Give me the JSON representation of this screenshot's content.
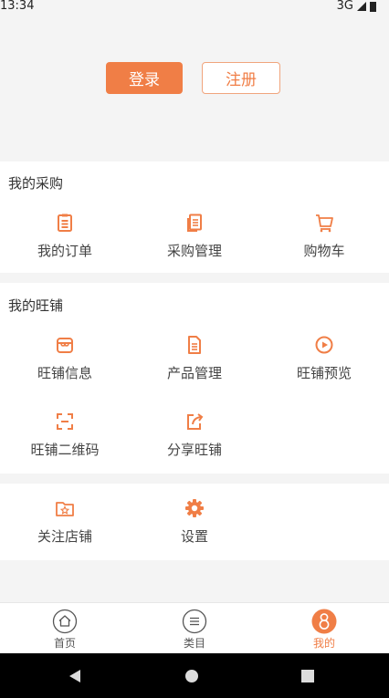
{
  "status_bar": {
    "time": "13:34",
    "network": "3G"
  },
  "auth": {
    "login_label": "登录",
    "register_label": "注册"
  },
  "purchase": {
    "title": "我的采购",
    "items": [
      {
        "label": "我的订单",
        "icon": "order-list-icon"
      },
      {
        "label": "采购管理",
        "icon": "documents-icon"
      },
      {
        "label": "购物车",
        "icon": "cart-icon"
      }
    ]
  },
  "shop": {
    "title": "我的旺铺",
    "items": [
      {
        "label": "旺铺信息",
        "icon": "store-icon"
      },
      {
        "label": "产品管理",
        "icon": "document-icon"
      },
      {
        "label": "旺铺预览",
        "icon": "play-circle-icon"
      },
      {
        "label": "旺铺二维码",
        "icon": "scan-icon"
      },
      {
        "label": "分享旺铺",
        "icon": "share-icon"
      }
    ]
  },
  "misc": {
    "items": [
      {
        "label": "关注店铺",
        "icon": "folder-star-icon"
      },
      {
        "label": "设置",
        "icon": "gear-icon"
      }
    ]
  },
  "tabbar": {
    "tabs": [
      {
        "label": "首页",
        "icon": "home-icon"
      },
      {
        "label": "类目",
        "icon": "list-icon"
      },
      {
        "label": "我的",
        "icon": "user-icon",
        "active": true
      }
    ]
  },
  "colors": {
    "accent": "#f07e46",
    "background": "#f4f4f4",
    "card": "#ffffff"
  }
}
